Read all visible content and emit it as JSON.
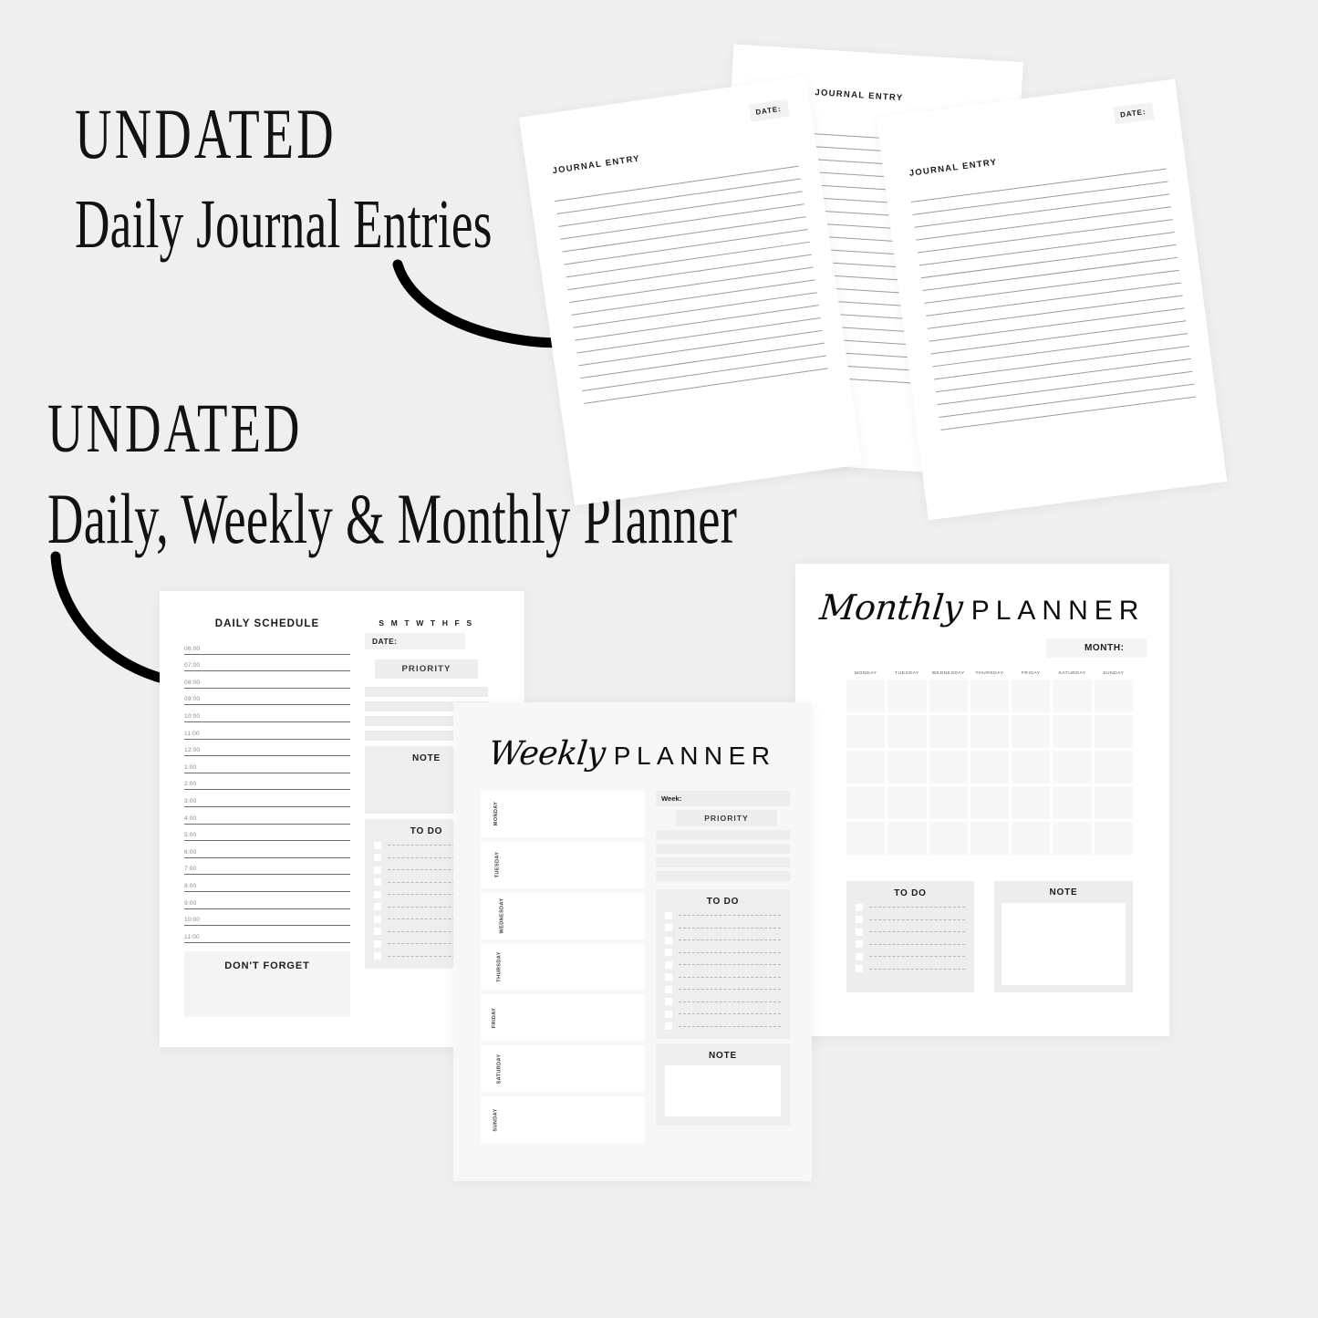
{
  "background_color": "#efefef",
  "headings": [
    {
      "kicker": "UNDATED",
      "title": "Daily Journal Entries"
    },
    {
      "kicker": "UNDATED",
      "title": "Daily, Weekly & Monthly Planner"
    }
  ],
  "arrows": [
    {
      "name": "arrow-to-journal-pages"
    },
    {
      "name": "arrow-to-daily-planner"
    }
  ],
  "journal_pages": [
    {
      "title": "JOURNAL ENTRY",
      "date_label": "DATE:",
      "line_count": 17
    },
    {
      "title": "JOURNAL ENTRY",
      "date_label": "",
      "line_count": 20
    },
    {
      "title": "JOURNAL ENTRY",
      "date_label": "DATE:",
      "line_count": 19
    }
  ],
  "daily_planner": {
    "schedule_title": "DAILY SCHEDULE",
    "times": [
      "06:00",
      "07:00",
      "08:00",
      "09:00",
      "10:00",
      "11:00",
      "12:00",
      "1:00",
      "2:00",
      "3:00",
      "4:00",
      "5:00",
      "6:00",
      "7:00",
      "8:00",
      "9:00",
      "10:00",
      "11:00"
    ],
    "dont_forget_label": "DON'T FORGET",
    "weekday_initials": "S M T W T H F S",
    "date_label": "DATE:",
    "priority_label": "PRIORITY",
    "priority_slots": 4,
    "note_label": "NOTE",
    "todo_label": "TO DO",
    "todo_rows": 10
  },
  "weekly_planner": {
    "title_script": "Weekly",
    "title_block": "PLANNER",
    "days": [
      "MONDAY",
      "TUESDAY",
      "WEDNESDAY",
      "THURSDAY",
      "FRIDAY",
      "SATURDAY",
      "SUNDAY"
    ],
    "week_label": "Week:",
    "priority_label": "PRIORITY",
    "priority_slots": 4,
    "todo_label": "TO DO",
    "todo_rows": 10,
    "note_label": "NOTE"
  },
  "monthly_planner": {
    "title_script": "Monthly",
    "title_block": "PLANNER",
    "month_label": "MONTH:",
    "day_headers": [
      "MONDAY",
      "TUESDAY",
      "WEDNESDAY",
      "THURSDAY",
      "FRIDAY",
      "SATURDAY",
      "SUNDAY"
    ],
    "grid_rows": 5,
    "grid_columns": 7,
    "todo_label": "TO DO",
    "todo_rows": 6,
    "note_label": "NOTE"
  }
}
